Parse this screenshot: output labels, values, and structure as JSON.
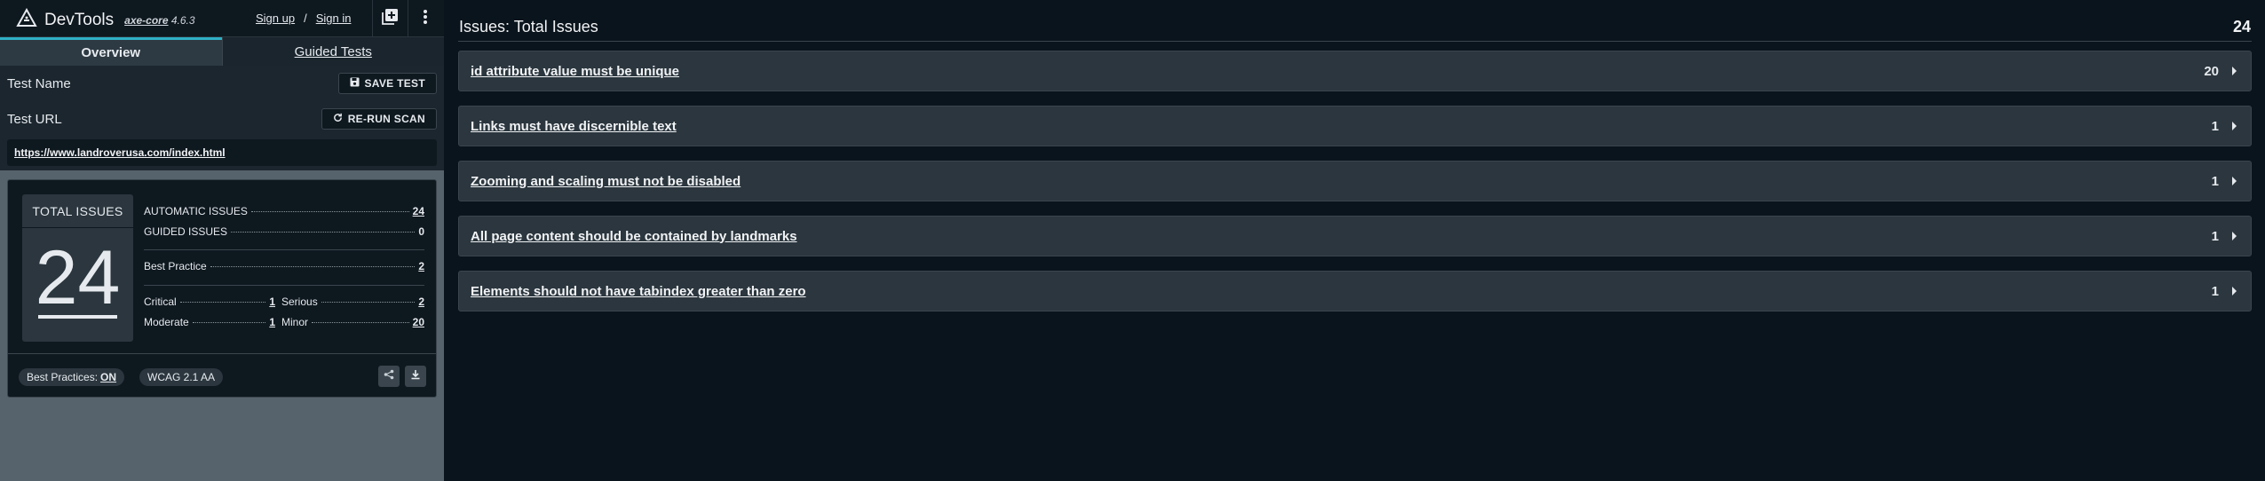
{
  "app": {
    "name": "DevTools",
    "engine": "axe-core",
    "version": "4.6.3",
    "sign_up": "Sign up",
    "separator": "/",
    "sign_in": "Sign in"
  },
  "tabs": [
    {
      "label": "Overview",
      "active": true
    },
    {
      "label": "Guided Tests",
      "active": false
    }
  ],
  "form": {
    "test_name_label": "Test Name",
    "save_test": "SAVE TEST",
    "test_url_label": "Test URL",
    "rerun_scan": "RE-RUN SCAN",
    "url": "https://www.landroverusa.com/index.html"
  },
  "summary": {
    "total_title": "TOTAL ISSUES",
    "total": "24",
    "automatic_label": "AUTOMATIC ISSUES",
    "automatic": "24",
    "guided_label": "GUIDED ISSUES",
    "guided": "0",
    "best_practice_label": "Best Practice",
    "best_practice": "2",
    "critical_label": "Critical",
    "critical": "1",
    "serious_label": "Serious",
    "serious": "2",
    "moderate_label": "Moderate",
    "moderate": "1",
    "minor_label": "Minor",
    "minor": "20",
    "best_practices_toggle_label": "Best Practices:",
    "best_practices_toggle_value": "ON",
    "standard": "WCAG 2.1 AA"
  },
  "issues_panel": {
    "title": "Issues: Total Issues",
    "count": "24",
    "issues": [
      {
        "label": "id attribute value must be unique",
        "count": "20"
      },
      {
        "label": "Links must have discernible text",
        "count": "1"
      },
      {
        "label": "Zooming and scaling must not be disabled",
        "count": "1"
      },
      {
        "label": "All page content should be contained by landmarks",
        "count": "1"
      },
      {
        "label": "Elements should not have tabindex greater than zero",
        "count": "1"
      }
    ]
  },
  "colors": {
    "accent": "#2fb0c6",
    "background": "#0a141c",
    "panel": "#2b363e"
  }
}
